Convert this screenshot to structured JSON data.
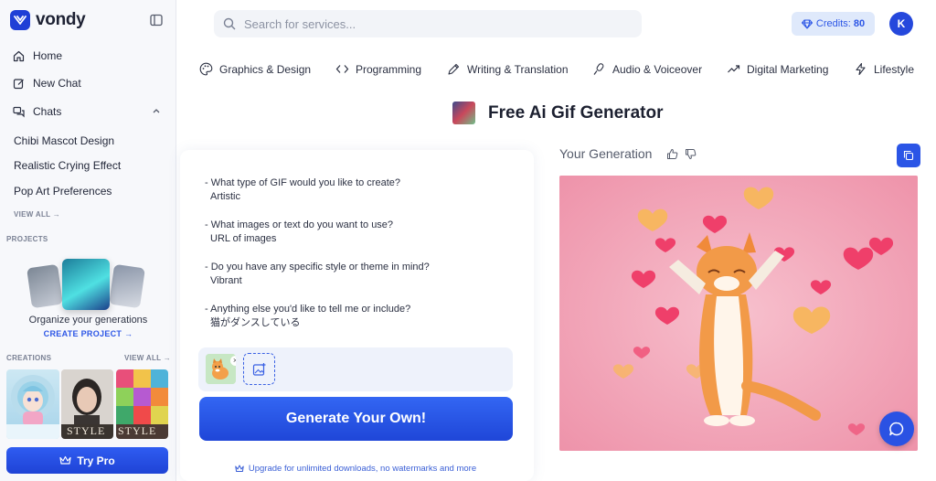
{
  "brand": {
    "name": "vondy"
  },
  "sidebar": {
    "nav": [
      {
        "label": "Home",
        "icon": "home-icon"
      },
      {
        "label": "New Chat",
        "icon": "edit-icon"
      },
      {
        "label": "Chats",
        "icon": "chats-icon"
      }
    ],
    "chats": [
      "Chibi Mascot Design",
      "Realistic Crying Effect",
      "Pop Art Preferences"
    ],
    "view_all": "VIEW ALL →",
    "projects_label": "PROJECTS",
    "projects_text": "Organize your generations",
    "create_project": "CREATE PROJECT →",
    "creations_label": "CREATIONS",
    "creations_view_all": "VIEW ALL →",
    "creation_thumbs": [
      {
        "caption": ""
      },
      {
        "caption": "STYLE"
      },
      {
        "caption": "STYLE"
      }
    ],
    "try_pro": "Try Pro"
  },
  "topbar": {
    "search_placeholder": "Search for services...",
    "credits_label": "Credits:",
    "credits_value": "80",
    "avatar_initial": "K"
  },
  "categories": [
    {
      "label": "Graphics & Design",
      "icon": "palette-icon"
    },
    {
      "label": "Programming",
      "icon": "code-icon"
    },
    {
      "label": "Writing & Translation",
      "icon": "pen-icon"
    },
    {
      "label": "Audio & Voiceover",
      "icon": "microphone-icon"
    },
    {
      "label": "Digital Marketing",
      "icon": "trending-up-icon"
    },
    {
      "label": "Lifestyle",
      "icon": "lightning-icon"
    }
  ],
  "page": {
    "title": "Free Ai Gif Generator"
  },
  "form": {
    "qa": [
      {
        "q": "- What type of GIF would you like to create?",
        "a": "Artistic"
      },
      {
        "q": "- What images or text do you want to use?",
        "a": "URL of images"
      },
      {
        "q": "- Do you have any specific style or theme in mind?",
        "a": "Vibrant"
      },
      {
        "q": "- Anything else you'd like to tell me or include?",
        "a": "猫がダンスしている"
      }
    ],
    "generate_button": "Generate Your Own!",
    "upgrade_text": "Upgrade for unlimited downloads, no watermarks and more"
  },
  "result": {
    "label": "Your Generation"
  },
  "colors": {
    "accent": "#2b55e6",
    "credits_bg": "#dfe9fb",
    "image_bg": "#f0a4b6"
  }
}
